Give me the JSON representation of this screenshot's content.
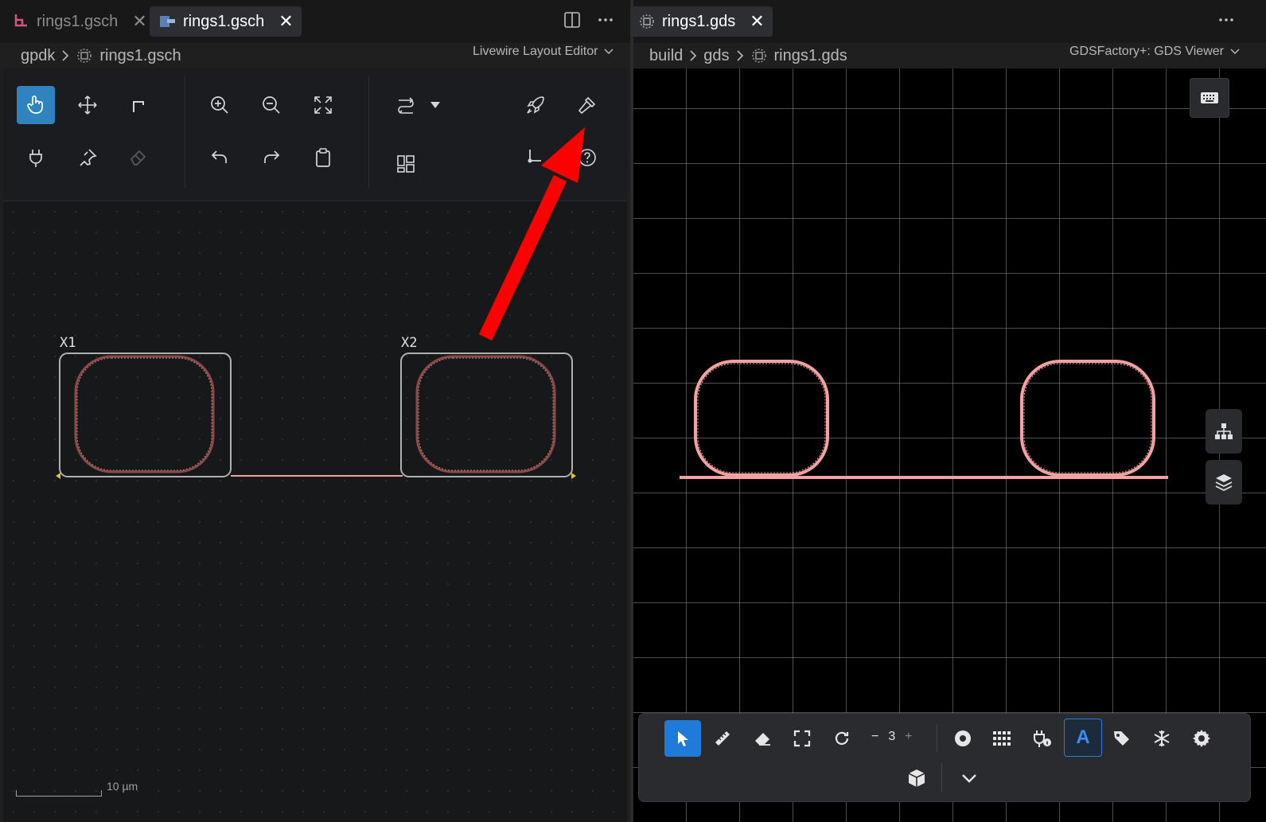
{
  "left": {
    "tabs": [
      {
        "label": "rings1.gsch",
        "close": "✕"
      },
      {
        "label": "rings1.gsch",
        "close": "✕"
      }
    ],
    "breadcrumb": {
      "folder": "gpdk",
      "file": "rings1.gsch"
    },
    "editor_mode": "Livewire Layout Editor",
    "instances": [
      {
        "label": "X1"
      },
      {
        "label": "X2"
      }
    ],
    "scale_label": "10 µm"
  },
  "right": {
    "tab": {
      "label": "rings1.gds",
      "close": "✕"
    },
    "breadcrumb": {
      "part1": "build",
      "part2": "gds",
      "file": "rings1.gds"
    },
    "viewer_mode": "GDSFactory+: GDS Viewer",
    "zoom": {
      "minus": "−",
      "value": "3",
      "plus": "+"
    },
    "text_tool_label": "A"
  },
  "colors": {
    "accent": "#2f84c0",
    "waveguide": "#f2a0a0",
    "annotation_arrow": "#ff0000"
  }
}
